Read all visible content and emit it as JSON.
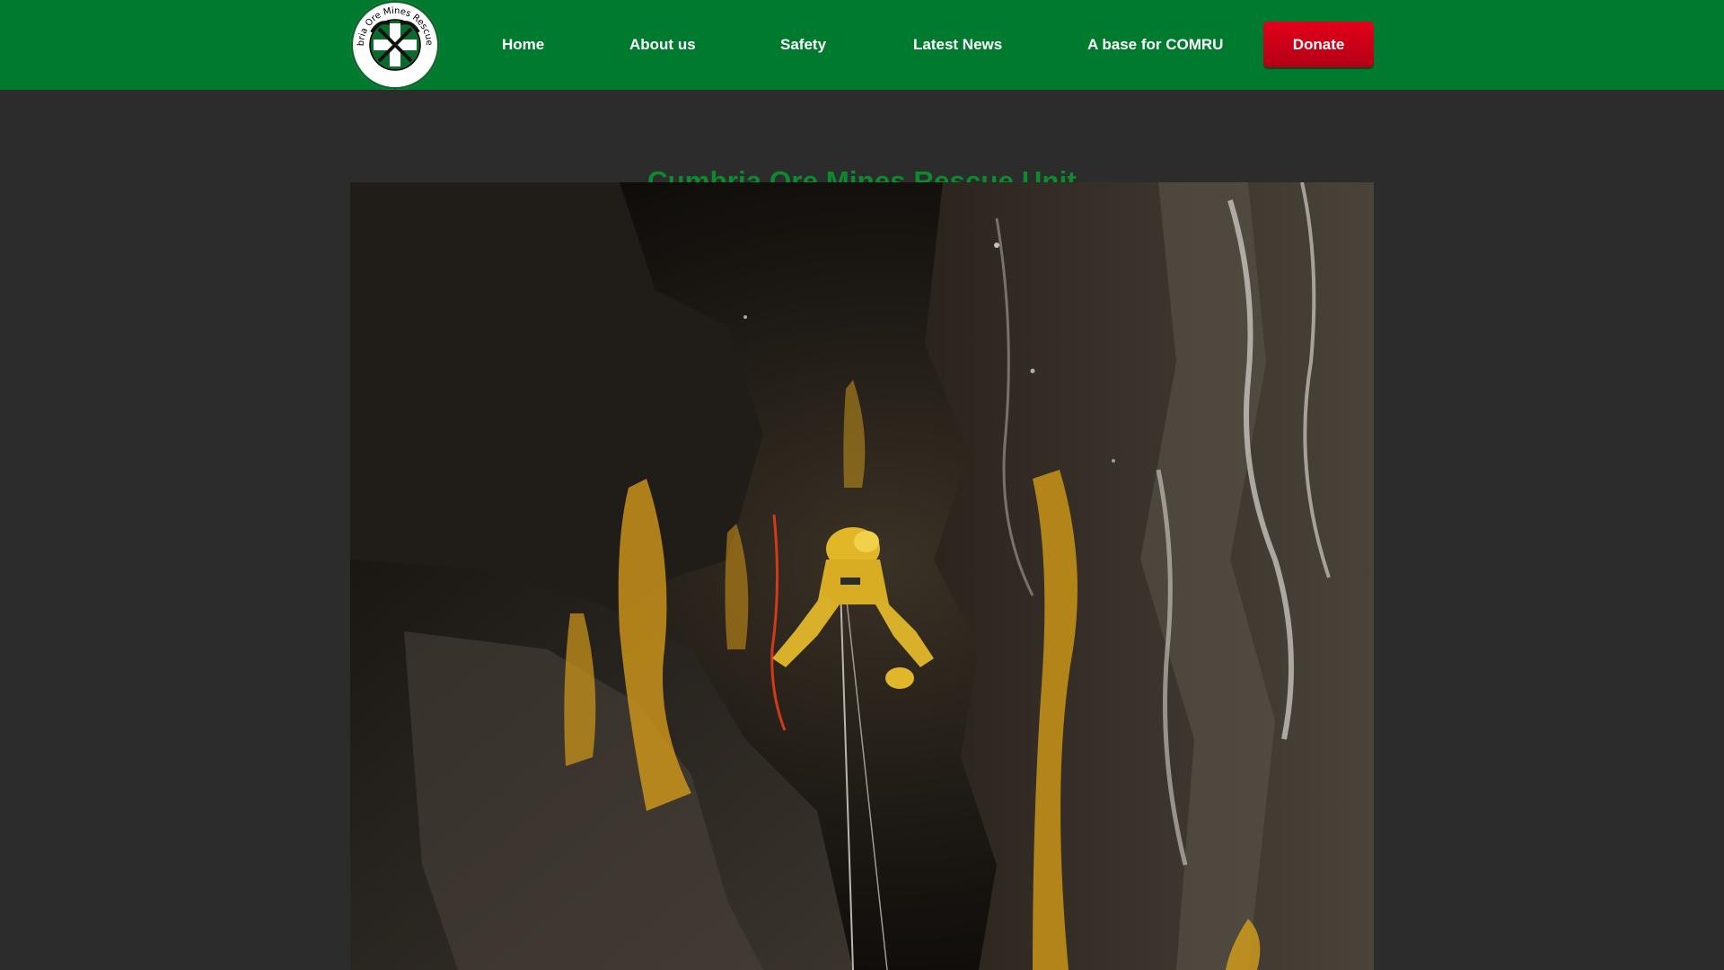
{
  "header": {
    "logo_text": "Cumbria Ore Mines Rescue Unit",
    "nav": [
      "Home",
      "About us",
      "Safety",
      "Latest News",
      "A base for COMRU"
    ],
    "donate_label": "Donate"
  },
  "main": {
    "title": "Cumbria Ore Mines Rescue Unit"
  },
  "colors": {
    "header_bg": "#007a2f",
    "page_bg": "#2c2c2c",
    "title": "#0b8a2e",
    "donate_bg": "#d0001a"
  }
}
